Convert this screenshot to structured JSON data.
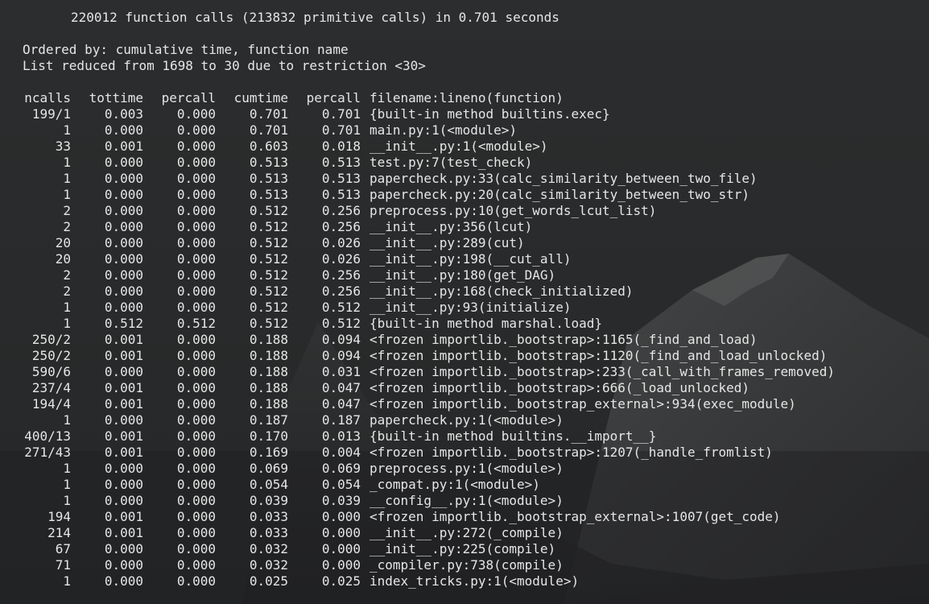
{
  "colors": {
    "background": "#2a2c2d",
    "text": "#e6e6e6"
  },
  "summary": "220012 function calls (213832 primitive calls) in 0.701 seconds",
  "ordered_by": "Ordered by: cumulative time, function name",
  "list_reduced": "List reduced from 1698 to 30 due to restriction <30>",
  "columns": [
    "ncalls",
    "tottime",
    "percall",
    "cumtime",
    "percall",
    "filename:lineno(function)"
  ],
  "rows": [
    [
      "199/1",
      "0.003",
      "0.000",
      "0.701",
      "0.701",
      "{built-in method builtins.exec}"
    ],
    [
      "1",
      "0.000",
      "0.000",
      "0.701",
      "0.701",
      "main.py:1(<module>)"
    ],
    [
      "33",
      "0.001",
      "0.000",
      "0.603",
      "0.018",
      "__init__.py:1(<module>)"
    ],
    [
      "1",
      "0.000",
      "0.000",
      "0.513",
      "0.513",
      "test.py:7(test_check)"
    ],
    [
      "1",
      "0.000",
      "0.000",
      "0.513",
      "0.513",
      "papercheck.py:33(calc_similarity_between_two_file)"
    ],
    [
      "1",
      "0.000",
      "0.000",
      "0.513",
      "0.513",
      "papercheck.py:20(calc_similarity_between_two_str)"
    ],
    [
      "2",
      "0.000",
      "0.000",
      "0.512",
      "0.256",
      "preprocess.py:10(get_words_lcut_list)"
    ],
    [
      "2",
      "0.000",
      "0.000",
      "0.512",
      "0.256",
      "__init__.py:356(lcut)"
    ],
    [
      "20",
      "0.000",
      "0.000",
      "0.512",
      "0.026",
      "__init__.py:289(cut)"
    ],
    [
      "20",
      "0.000",
      "0.000",
      "0.512",
      "0.026",
      "__init__.py:198(__cut_all)"
    ],
    [
      "2",
      "0.000",
      "0.000",
      "0.512",
      "0.256",
      "__init__.py:180(get_DAG)"
    ],
    [
      "2",
      "0.000",
      "0.000",
      "0.512",
      "0.256",
      "__init__.py:168(check_initialized)"
    ],
    [
      "1",
      "0.000",
      "0.000",
      "0.512",
      "0.512",
      "__init__.py:93(initialize)"
    ],
    [
      "1",
      "0.512",
      "0.512",
      "0.512",
      "0.512",
      "{built-in method marshal.load}"
    ],
    [
      "250/2",
      "0.001",
      "0.000",
      "0.188",
      "0.094",
      "<frozen importlib._bootstrap>:1165(_find_and_load)"
    ],
    [
      "250/2",
      "0.001",
      "0.000",
      "0.188",
      "0.094",
      "<frozen importlib._bootstrap>:1120(_find_and_load_unlocked)"
    ],
    [
      "590/6",
      "0.000",
      "0.000",
      "0.188",
      "0.031",
      "<frozen importlib._bootstrap>:233(_call_with_frames_removed)"
    ],
    [
      "237/4",
      "0.001",
      "0.000",
      "0.188",
      "0.047",
      "<frozen importlib._bootstrap>:666(_load_unlocked)"
    ],
    [
      "194/4",
      "0.001",
      "0.000",
      "0.188",
      "0.047",
      "<frozen importlib._bootstrap_external>:934(exec_module)"
    ],
    [
      "1",
      "0.000",
      "0.000",
      "0.187",
      "0.187",
      "papercheck.py:1(<module>)"
    ],
    [
      "400/13",
      "0.001",
      "0.000",
      "0.170",
      "0.013",
      "{built-in method builtins.__import__}"
    ],
    [
      "271/43",
      "0.001",
      "0.000",
      "0.169",
      "0.004",
      "<frozen importlib._bootstrap>:1207(_handle_fromlist)"
    ],
    [
      "1",
      "0.000",
      "0.000",
      "0.069",
      "0.069",
      "preprocess.py:1(<module>)"
    ],
    [
      "1",
      "0.000",
      "0.000",
      "0.054",
      "0.054",
      "_compat.py:1(<module>)"
    ],
    [
      "1",
      "0.000",
      "0.000",
      "0.039",
      "0.039",
      "__config__.py:1(<module>)"
    ],
    [
      "194",
      "0.001",
      "0.000",
      "0.033",
      "0.000",
      "<frozen importlib._bootstrap_external>:1007(get_code)"
    ],
    [
      "214",
      "0.001",
      "0.000",
      "0.033",
      "0.000",
      "__init__.py:272(_compile)"
    ],
    [
      "67",
      "0.000",
      "0.000",
      "0.032",
      "0.000",
      "__init__.py:225(compile)"
    ],
    [
      "71",
      "0.000",
      "0.000",
      "0.032",
      "0.000",
      "_compiler.py:738(compile)"
    ],
    [
      "1",
      "0.000",
      "0.000",
      "0.025",
      "0.025",
      "index_tricks.py:1(<module>)"
    ]
  ]
}
